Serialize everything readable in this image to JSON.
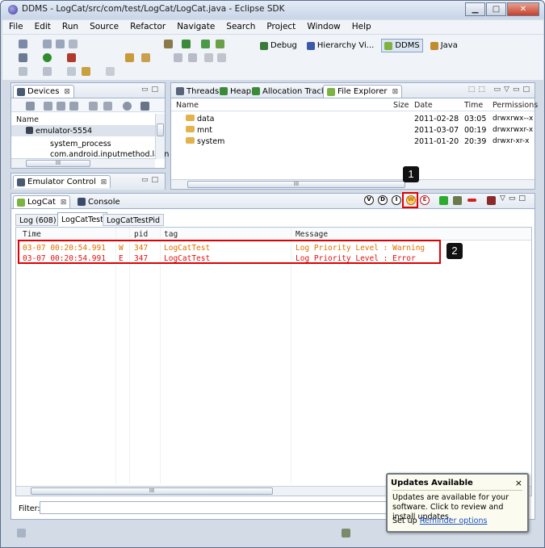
{
  "window": {
    "title": "DDMS - LogCat/src/com/test/LogCat/LogCat.java - Eclipse SDK",
    "minimize": "▁",
    "maximize": "□",
    "close": "✕"
  },
  "menu": [
    "File",
    "Edit",
    "Run",
    "Source",
    "Refactor",
    "Navigate",
    "Search",
    "Project",
    "Window",
    "Help"
  ],
  "perspectives": [
    {
      "label": "Debug",
      "color": "#3a7a3a"
    },
    {
      "label": "Hierarchy Vi...",
      "color": "#3a5aa8"
    },
    {
      "label": "DDMS",
      "color": "#7cb342"
    },
    {
      "label": "Java",
      "color": "#c28b2e"
    }
  ],
  "devices": {
    "tab": "Devices",
    "header": "Name",
    "items": [
      {
        "label": "emulator-5554",
        "level": 0
      },
      {
        "label": "system_process",
        "level": 1
      },
      {
        "label": "com.android.inputmethod.latin",
        "level": 1
      }
    ]
  },
  "emulator_control": {
    "tab": "Emulator Control"
  },
  "fe_tabs": [
    {
      "label": "Threads"
    },
    {
      "label": "Heap"
    },
    {
      "label": "Allocation Tracker"
    },
    {
      "label": "File Explorer"
    }
  ],
  "file_explorer": {
    "headers": {
      "name": "Name",
      "size": "Size",
      "date": "Date",
      "time": "Time",
      "permissions": "Permissions"
    },
    "rows": [
      {
        "name": "data",
        "date": "2011-02-28",
        "time": "03:05",
        "perm": "drwxrwx--x"
      },
      {
        "name": "mnt",
        "date": "2011-03-07",
        "time": "00:19",
        "perm": "drwxrwxr-x"
      },
      {
        "name": "system",
        "date": "2011-01-20",
        "time": "20:39",
        "perm": "drwxr-xr-x"
      }
    ]
  },
  "bottom_tabs": [
    {
      "label": "LogCat"
    },
    {
      "label": "Console"
    }
  ],
  "log_levels": [
    "V",
    "D",
    "I",
    "W",
    "E"
  ],
  "log_subtabs": [
    {
      "label": "Log (608)"
    },
    {
      "label": "LogCatTest"
    },
    {
      "label": "LogCatTestPid"
    }
  ],
  "log_table": {
    "headers": {
      "time": "Time",
      "pid": "pid",
      "tag": "tag",
      "message": "Message"
    },
    "rows": [
      {
        "time": "03-07 00:20:54.991",
        "level": "W",
        "pid": "347",
        "tag": "LogCatTest",
        "message": "Log Priority Level : Warning",
        "msgColor": "#e07000"
      },
      {
        "time": "03-07 00:20:54.991",
        "level": "E",
        "pid": "347",
        "tag": "LogCatTest",
        "message": "Log Priority Level : Error",
        "msgColor": "#e01010"
      }
    ]
  },
  "filter": {
    "label": "Filter:",
    "value": ""
  },
  "annotations": {
    "one": "1",
    "two": "2"
  },
  "popup": {
    "title": "Updates Available",
    "close": "×",
    "body": "Updates are available for your software. Click to review and install updates.",
    "setup_prefix": "Set up ",
    "setup_link": "Reminder options"
  },
  "scroll_grip": "III"
}
